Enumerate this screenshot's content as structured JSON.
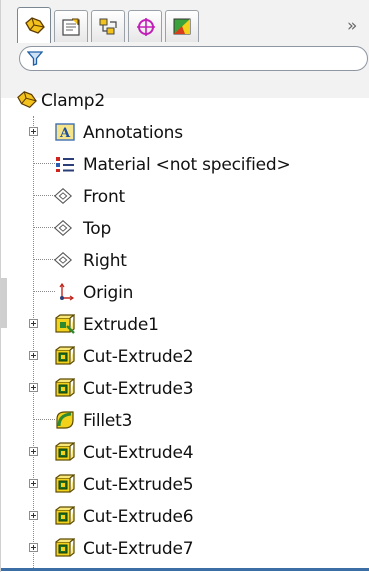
{
  "feature_tree": {
    "tabs": [
      {
        "name": "featuremanager-icon",
        "active": true
      },
      {
        "name": "propertymanager-icon",
        "active": false
      },
      {
        "name": "configurationmanager-icon",
        "active": false
      },
      {
        "name": "dimxpert-icon",
        "active": false
      },
      {
        "name": "display-manager-icon",
        "active": false
      }
    ],
    "expand_glyph": "»",
    "filter": {
      "icon": "filter-icon",
      "value": ""
    },
    "root": {
      "label": "Clamp2",
      "icon": "part-icon"
    },
    "items": [
      {
        "label": "Annotations",
        "icon": "annotations-icon",
        "expandable": true
      },
      {
        "label": "Material <not specified>",
        "icon": "material-icon",
        "expandable": false
      },
      {
        "label": "Front",
        "icon": "plane-icon",
        "expandable": false
      },
      {
        "label": "Top",
        "icon": "plane-icon",
        "expandable": false
      },
      {
        "label": "Right",
        "icon": "plane-icon",
        "expandable": false
      },
      {
        "label": "Origin",
        "icon": "origin-icon",
        "expandable": false
      },
      {
        "label": "Extrude1",
        "icon": "extrude-icon",
        "expandable": true
      },
      {
        "label": "Cut-Extrude2",
        "icon": "cut-extrude-icon",
        "expandable": true
      },
      {
        "label": "Cut-Extrude3",
        "icon": "cut-extrude-icon",
        "expandable": true
      },
      {
        "label": "Fillet3",
        "icon": "fillet-icon",
        "expandable": false
      },
      {
        "label": "Cut-Extrude4",
        "icon": "cut-extrude-icon",
        "expandable": true
      },
      {
        "label": "Cut-Extrude5",
        "icon": "cut-extrude-icon",
        "expandable": true
      },
      {
        "label": "Cut-Extrude6",
        "icon": "cut-extrude-icon",
        "expandable": true
      },
      {
        "label": "Cut-Extrude7",
        "icon": "cut-extrude-icon",
        "expandable": true
      }
    ]
  },
  "colors": {
    "accent_blue": "#3b6ea5",
    "feature_green": "#2f8a2f",
    "feature_yellow": "#f2d21a"
  }
}
